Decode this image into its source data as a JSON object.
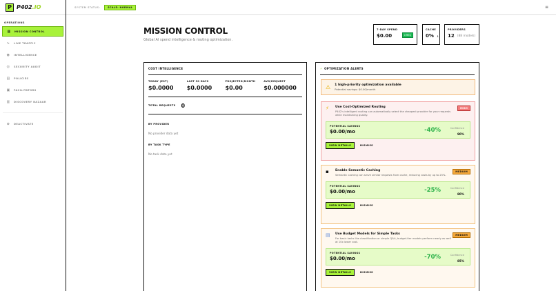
{
  "brand": {
    "logo_letter": "P",
    "name": "P402",
    "name_accent": ".IO"
  },
  "sidebar": {
    "section_label": "OPERATIONS",
    "items": [
      {
        "label": "MISSION CONTROL",
        "icon": "grid-icon"
      },
      {
        "label": "LIVE TRAFFIC",
        "icon": "pulse-icon"
      },
      {
        "label": "INTELLIGENCE",
        "icon": "brain-icon"
      },
      {
        "label": "SECURITY AUDIT",
        "icon": "shield-icon"
      },
      {
        "label": "POLICIES",
        "icon": "document-icon"
      },
      {
        "label": "FACILITATORS",
        "icon": "box-icon"
      },
      {
        "label": "DISCOVERY BAZAAR",
        "icon": "store-icon"
      }
    ],
    "footer_item": {
      "label": "DEACTIVATE",
      "icon": "plug-icon"
    }
  },
  "topbar": {
    "status_label": "SYSTEM STATUS:",
    "status_value": "SCALE: NORMAL",
    "menu_icon": "menu-icon"
  },
  "header": {
    "title": "MISSION CONTROL",
    "subtitle": "Global AI spend intelligence & routing optimization."
  },
  "stats": {
    "spend": {
      "label": "7-DAY SPEND",
      "value": "$0.00",
      "badge": "0 REQ"
    },
    "cache": {
      "label": "CACHE",
      "value": "0%",
      "trend": "↓"
    },
    "providers": {
      "label": "PROVIDERS",
      "value": "12",
      "sub": "(88 models)"
    }
  },
  "cost_intel": {
    "title": "COST INTELLIGENCE",
    "metrics": [
      {
        "label": "TODAY (EST)",
        "value": "$0.0000"
      },
      {
        "label": "LAST 30 DAYS",
        "value": "$0.0000"
      },
      {
        "label": "PROJECTED/MONTH",
        "value": "$0.00"
      },
      {
        "label": "AVG/REQUEST",
        "value": "$0.000000"
      }
    ],
    "total_label": "TOTAL REQUESTS",
    "total_value": "0",
    "by_provider": {
      "title": "BY PROVIDER",
      "empty": "No provider data yet"
    },
    "by_task": {
      "title": "BY TASK TYPE",
      "empty": "No task data yet"
    }
  },
  "alerts": {
    "title": "OPTIMIZATION ALERTS",
    "summary": {
      "title": "1 high-priority optimization available",
      "sub": "Potential savings: $0.00/month"
    },
    "recommendations": [
      {
        "icon": "lightning-icon",
        "title": "Use Cost-Optimized Routing",
        "desc": "P402's intelligent routing can automatically select the cheapest provider for your requests while maintaining quality.",
        "priority": "HIGH",
        "savings_label": "POTENTIAL SAVINGS",
        "savings_value": "$0.00/mo",
        "percent": "-40%",
        "confidence_label": "Confidence",
        "confidence_value": "90%",
        "view_label": "VIEW DETAILS",
        "dismiss_label": "DISMISS"
      },
      {
        "icon": "floppy-icon",
        "title": "Enable Semantic Caching",
        "desc": "Semantic caching can serve similar requests from cache, reducing costs by up to 25%.",
        "priority": "MEDIUM",
        "savings_label": "POTENTIAL SAVINGS",
        "savings_value": "$0.00/mo",
        "percent": "-25%",
        "confidence_label": "Confidence",
        "confidence_value": "80%",
        "view_label": "VIEW DETAILS",
        "dismiss_label": "DISMISS"
      },
      {
        "icon": "document-icon",
        "title": "Use Budget Models for Simple Tasks",
        "desc": "For basic tasks like classification or simple Q&A, budget-tier models perform nearly as well at 10x lower cost.",
        "priority": "MEDIUM",
        "savings_label": "POTENTIAL SAVINGS",
        "savings_value": "$0.00/mo",
        "percent": "-70%",
        "confidence_label": "Confidence",
        "confidence_value": "85%",
        "view_label": "VIEW DETAILS",
        "dismiss_label": "DISMISS"
      }
    ]
  },
  "colors": {
    "accent": "#a8f23a",
    "high": "#f47b7b",
    "medium": "#f5a83a",
    "savings_green": "#2db24a"
  }
}
